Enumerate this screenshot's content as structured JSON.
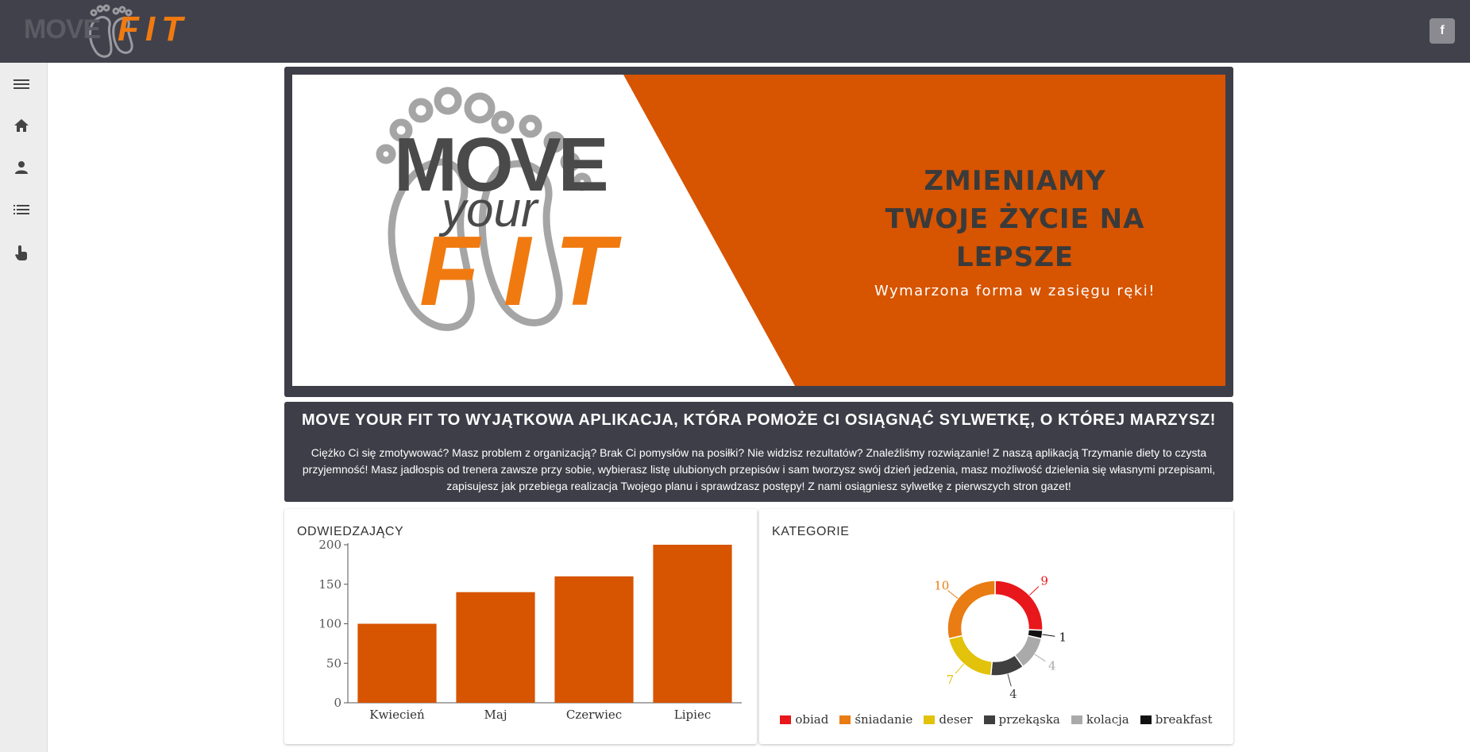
{
  "header": {
    "logo_text_move": "MOVE",
    "logo_text_fit": "FIT",
    "facebook_label": "f"
  },
  "sidebar": {
    "items": [
      {
        "icon": "menu-icon"
      },
      {
        "icon": "home-icon"
      },
      {
        "icon": "person-icon"
      },
      {
        "icon": "list-icon"
      },
      {
        "icon": "touch-icon"
      }
    ]
  },
  "hero": {
    "logo_word_move": "MOVE",
    "logo_word_your": "your",
    "logo_word_fit": "FIT",
    "title_lines": [
      "ZMIENIAMY",
      "TWOJE ŻYCIE NA",
      "LEPSZE"
    ],
    "subtitle": "Wymarzona forma w zasięgu ręki!",
    "colors": {
      "orange": "#d75400",
      "dark": "#3e3e48",
      "logo_gray": "#4a4a4a",
      "logo_orange": "#f07a10"
    }
  },
  "intro": {
    "title": "MOVE YOUR FIT TO WYJĄTKOWA APLIKACJA, KTÓRA POMOŻE CI OSIĄGNĄĆ SYLWETKĘ, O KTÓREJ MARZYSZ!",
    "text": "Ciężko Ci się zmotywować? Masz problem z organizacją? Brak Ci pomysłów na posiłki? Nie widzisz rezultatów? Znaleźliśmy rozwiązanie! Z naszą aplikacją Trzymanie diety to czysta przyjemność! Masz jadłospis od trenera zawsze przy sobie, wybierasz listę ulubionych przepisów i sam tworzysz swój dzień jedzenia, masz możliwość dzielenia się własnymi przepisami, zapisujesz jak przebiega realizacja Twojego planu i sprawdzasz postępy! Z nami osiągniesz sylwetkę z pierwszych stron gazet!"
  },
  "visitors_card": {
    "title": "ODWIEDZAJĄCY"
  },
  "categories_card": {
    "title": "KATEGORIE"
  },
  "chart_data": [
    {
      "type": "bar",
      "title": "ODWIEDZAJĄCY",
      "categories": [
        "Kwiecień",
        "Maj",
        "Czerwiec",
        "Lipiec"
      ],
      "values": [
        100,
        140,
        160,
        200
      ],
      "ylim": [
        0,
        200
      ],
      "yticks": [
        0,
        50,
        100,
        150,
        200
      ],
      "color": "#d75400",
      "grid": false
    },
    {
      "type": "pie",
      "title": "KATEGORIE",
      "donut": true,
      "labels": [
        "obiad",
        "breakfast",
        "kolacja",
        "przekąska",
        "deser",
        "śniadanie"
      ],
      "values": [
        9,
        1,
        4,
        4,
        7,
        10
      ],
      "colors": [
        "#e8171b",
        "#111111",
        "#aaaaaa",
        "#3f3f3f",
        "#e2c20a",
        "#e97c12"
      ],
      "legend_order": [
        "obiad",
        "śniadanie",
        "deser",
        "przekąska",
        "kolacja",
        "breakfast"
      ],
      "legend": "bottom"
    }
  ]
}
